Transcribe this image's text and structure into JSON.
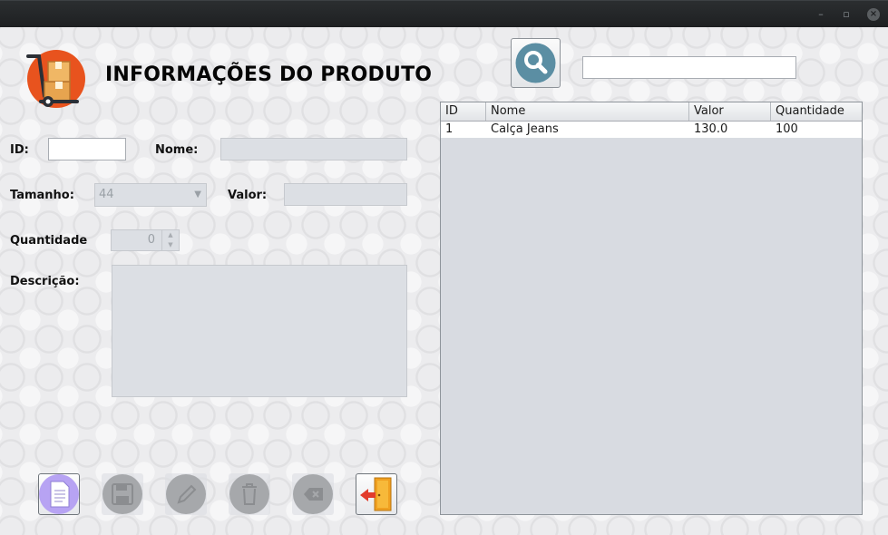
{
  "window": {
    "controls": {
      "minimize": "–",
      "maximize": "▫",
      "close": "×"
    }
  },
  "header": {
    "title": "INFORMAÇÕES DO PRODUTO"
  },
  "form": {
    "id": {
      "label": "ID:",
      "value": ""
    },
    "nome": {
      "label": "Nome:",
      "value": ""
    },
    "tamanho": {
      "label": "Tamanho:",
      "value": "44"
    },
    "valor": {
      "label": "Valor:",
      "value": ""
    },
    "quantidade": {
      "label": "Quantidade",
      "value": "0"
    },
    "descricao": {
      "label": "Descrição:",
      "value": ""
    }
  },
  "search": {
    "value": ""
  },
  "table": {
    "columns": [
      "ID",
      "Nome",
      "Valor",
      "Quantidade"
    ],
    "rows": [
      [
        "1",
        "Calça Jeans",
        "130.0",
        "100"
      ]
    ]
  },
  "toolbar": {
    "buttons": [
      {
        "name": "new-button",
        "icon": "document-icon",
        "enabled": true
      },
      {
        "name": "save-button",
        "icon": "floppy-disk-icon",
        "enabled": false
      },
      {
        "name": "edit-button",
        "icon": "pencil-icon",
        "enabled": false
      },
      {
        "name": "delete-button",
        "icon": "trash-icon",
        "enabled": false
      },
      {
        "name": "clear-button",
        "icon": "backspace-icon",
        "enabled": false
      },
      {
        "name": "exit-button",
        "icon": "exit-door-icon",
        "enabled": true
      }
    ]
  },
  "colors": {
    "accent_orange": "#e8531e",
    "search_teal": "#5b8ea3",
    "new_button_purple": "#b7a3f3",
    "disabled_gray": "#a6a8ab",
    "exit_orange": "#f0a020",
    "exit_arrow_red": "#e23c2c"
  }
}
